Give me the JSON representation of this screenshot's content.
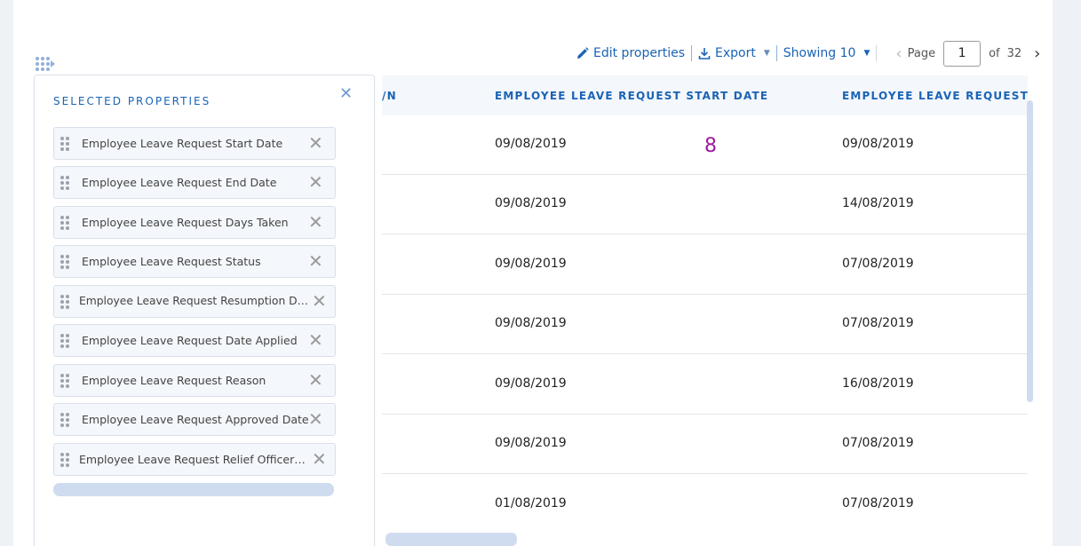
{
  "toolbar": {
    "edit_label": "Edit properties",
    "export_label": "Export",
    "showing_label": "Showing 10",
    "page_label": "Page",
    "page_value": "1",
    "of_label": "of",
    "total_pages": "32"
  },
  "table": {
    "columns": [
      "/N",
      "EMPLOYEE LEAVE REQUEST START DATE",
      "EMPLOYEE LEAVE REQUEST E"
    ],
    "rows": [
      {
        "start": "09/08/2019",
        "end": "09/08/2019"
      },
      {
        "start": "09/08/2019",
        "end": "14/08/2019"
      },
      {
        "start": "09/08/2019",
        "end": "07/08/2019"
      },
      {
        "start": "09/08/2019",
        "end": "07/08/2019"
      },
      {
        "start": "09/08/2019",
        "end": "16/08/2019"
      },
      {
        "start": "09/08/2019",
        "end": "07/08/2019"
      },
      {
        "start": "01/08/2019",
        "end": "07/08/2019"
      }
    ],
    "annotation": "8"
  },
  "panel": {
    "title": "SELECTED PROPERTIES",
    "items": [
      "Employee Leave Request Start Date",
      "Employee Leave Request End Date",
      "Employee Leave Request Days Taken",
      "Employee Leave Request Status",
      "Employee Leave Request Resumption Date",
      "Employee Leave Request Date Applied",
      "Employee Leave Request Reason",
      "Employee Leave Request Approved Date",
      "Employee Leave Request Relief Officer Ap..."
    ]
  },
  "colors": {
    "accent": "#1a63b6",
    "annotation": "#9c1a9c"
  }
}
